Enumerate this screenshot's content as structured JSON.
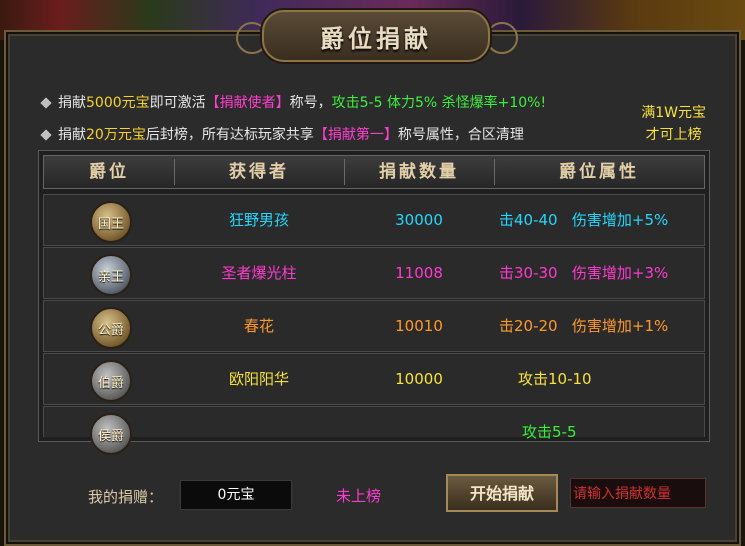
{
  "title": "爵位捐献",
  "info": {
    "line1": {
      "prefix": "捐献",
      "amount": "5000元宝",
      "mid": "即可激活",
      "title_name": "【捐献使者】",
      "suffix": "称号，",
      "reward": "攻击5-5 体力5% 杀怪爆率+10%!"
    },
    "line2": {
      "prefix": "捐献",
      "amount": "20万元宝",
      "mid": "后封榜，所有达标玩家共享",
      "title_name": "【捐献第一】",
      "suffix": "称号属性，合区清理"
    },
    "side_note_line1": "满1W元宝",
    "side_note_line2": "才可上榜"
  },
  "table": {
    "headers": [
      "爵位",
      "获得者",
      "捐献数量",
      "爵位属性"
    ],
    "rows": [
      {
        "rank": "国王",
        "player": "狂野男孩",
        "amount": "30000",
        "attr": "击40-40",
        "bonus": "伤害增加+5%"
      },
      {
        "rank": "亲王",
        "player": "圣者爆光柱",
        "amount": "11008",
        "attr": "击30-30",
        "bonus": "伤害增加+3%"
      },
      {
        "rank": "公爵",
        "player": "春花",
        "amount": "10010",
        "attr": "击20-20",
        "bonus": "伤害增加+1%"
      },
      {
        "rank": "伯爵",
        "player": "欧阳阳华",
        "amount": "10000",
        "attr": "攻击10-10",
        "bonus": ""
      },
      {
        "rank": "侯爵",
        "player": "",
        "amount": "",
        "attr": "攻击5-5",
        "bonus": ""
      }
    ]
  },
  "bottom": {
    "label": "我的捐赠：",
    "my_amount": "0元宝",
    "status": "未上榜",
    "button": "开始捐献",
    "input_placeholder": "请输入捐献数量"
  },
  "colors": {
    "row1": "#22d8ff",
    "row2": "#ff3ad0",
    "row3": "#ff9a2a",
    "row4": "#f6e23a",
    "row5": "#38f038"
  }
}
